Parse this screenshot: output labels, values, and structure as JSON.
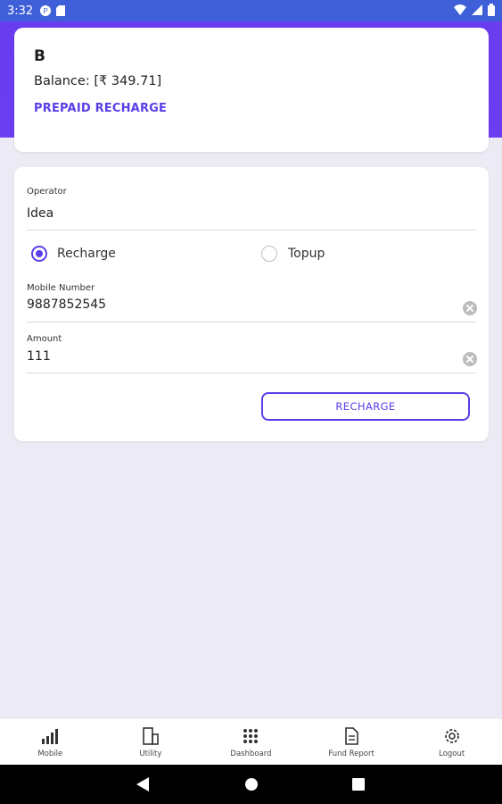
{
  "status_bar": {
    "time": "3:32",
    "left_icons": [
      "notification-p-icon",
      "sim-card-icon"
    ],
    "right_icons": [
      "wifi-icon",
      "signal-icon",
      "battery-icon"
    ]
  },
  "account": {
    "name": "B",
    "balance": "Balance: [₹ 349.71]",
    "link": "PREPAID RECHARGE"
  },
  "form": {
    "operator_label": "Operator",
    "operator_value": "Idea",
    "radio_recharge": "Recharge",
    "radio_topup": "Topup",
    "mobile_label": "Mobile Number",
    "mobile_value": "9887852545",
    "amount_label": "Amount",
    "amount_value": "111",
    "submit_label": "RECHARGE"
  },
  "bottom_nav": [
    {
      "label": "Mobile",
      "icon": "signal-bars-icon"
    },
    {
      "label": "Utility",
      "icon": "building-icon"
    },
    {
      "label": "Dashboard",
      "icon": "grid-icon"
    },
    {
      "label": "Fund Report",
      "icon": "document-icon"
    },
    {
      "label": "Logout",
      "icon": "gear-icon"
    }
  ],
  "colors": {
    "accent": "#5b3ee8",
    "header": "#6a3cf0",
    "status_bar": "#3f5fd8"
  }
}
